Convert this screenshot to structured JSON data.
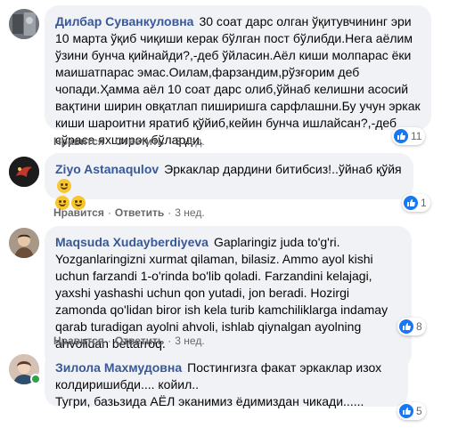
{
  "colors": {
    "link": "#385898",
    "bubble": "#f0f2f5",
    "meta": "#65676b",
    "like": "#1877f2",
    "online": "#31a24c"
  },
  "icons": {
    "like": "like-icon",
    "emoji": "grinning-face-emoji"
  },
  "comments": [
    {
      "author": "Дилбар Суванкуловна",
      "text": "30 соат дарс олган ўқитувчининг эри 10 марта ўқиб чиқиши керак бўлган пост бўлибди.Негa аёлим ўзини бунча қийнайди?,-деб ўйласин.Аёл киши молпарас ёки маишатпарас эмас.Оилам,фарзандим,рўзғорим деб чопади.Ҳамма аёл 10 соат дарс олиб,ўйнаб келишни асосий вақтини ширин овқатлап пиширишга сарфлашни.Бу учун эркак киши шароитни яратиб қўйиб,кейин бунча ишлайсан?,-деб сўраса яхшироқ бўларди.",
      "like": "Нравится",
      "reply": "Ответить",
      "time": "3 нед.",
      "reactions": "11"
    },
    {
      "author": "Ziyo Astanaqulov",
      "text": "Эркаклар дардини битибсиз!..ўйнаб қўйя",
      "like": "Нравится",
      "reply": "Ответить",
      "time": "3 нед.",
      "reactions": "1"
    },
    {
      "author": "Maqsuda Xudayberdiyeva",
      "text": "Gaplaringiz juda to'g'ri. Yozganlaringizni xurmat qilaman, bilasiz. Ammo ayol kishi uchun farzandi 1-o'rinda bo'lib qoladi. Farzandini kelajagi, yaxshi yashashi uchun qon yutadi, jon beradi. Hozirgi zamonda qo'lidan biror ish kela turib kamchiliklarga indamay qarab turadigan ayolni ahvoli, ishlab qiynalgan ayolning ahvolidan bettarroq.",
      "like": "Нравится",
      "reply": "Ответить",
      "time": "3 нед.",
      "reactions": "8"
    },
    {
      "author": "Зилола Махмудовна",
      "text": "Постингизга факат эркаклар изох колдиришибди.... койил..\nТугри, базьзида АЁЛ эканимиз ёдимиздан чикади......",
      "reactions": "5"
    }
  ]
}
